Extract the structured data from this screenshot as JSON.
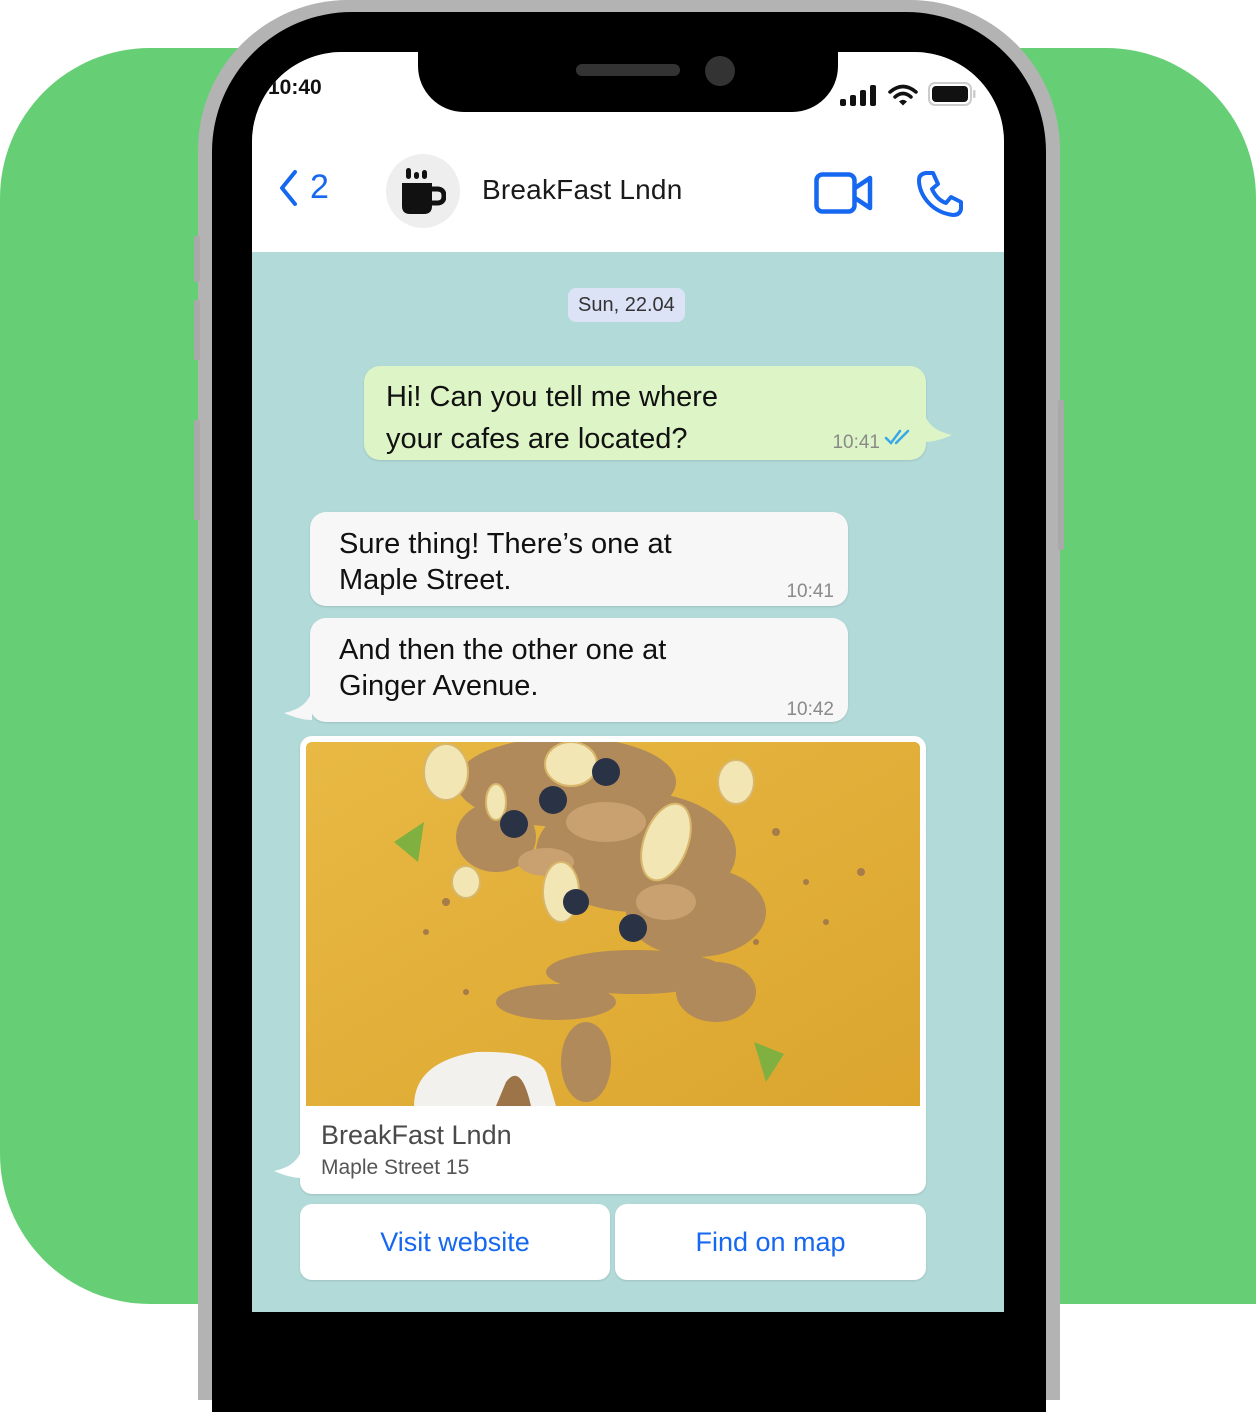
{
  "status_bar": {
    "time": "10:40",
    "icons": [
      "signal-bars-icon",
      "wifi-icon",
      "battery-icon"
    ]
  },
  "header": {
    "back_label": "2",
    "back_icon": "chevron-left-icon",
    "avatar_icon": "coffee-mug-icon",
    "contact_name": "BreakFast Lndn",
    "video_call_icon": "video-camera-icon",
    "voice_call_icon": "phone-icon"
  },
  "chat": {
    "date_separator": "Sun, 22.04",
    "messages": [
      {
        "direction": "outgoing",
        "text": "Hi! Can you tell me where\nyour cafes are located?",
        "time": "10:41",
        "status": "read",
        "status_icon": "double-check-icon"
      },
      {
        "direction": "incoming",
        "text": "Sure thing! There’s one at\nMaple Street.",
        "time": "10:41"
      },
      {
        "direction": "incoming",
        "text": "And then the other one at\nGinger Avenue.",
        "time": "10:42"
      }
    ],
    "card": {
      "image_alt": "Granola with banana, blueberries and kiwi falling into a bowl on a yellow background",
      "title": "BreakFast Lndn",
      "subtitle": "Maple Street 15",
      "buttons": [
        {
          "label": "Visit website"
        },
        {
          "label": "Find on map"
        }
      ]
    }
  },
  "colors": {
    "background_green": "#66cf75",
    "chat_background": "#b2dad9",
    "outgoing_bubble": "#ddf5c6",
    "incoming_bubble": "#f7f7f7",
    "accent_blue": "#1668f0",
    "read_ticks": "#3aa7e8",
    "date_chip": "#dde3f7"
  }
}
